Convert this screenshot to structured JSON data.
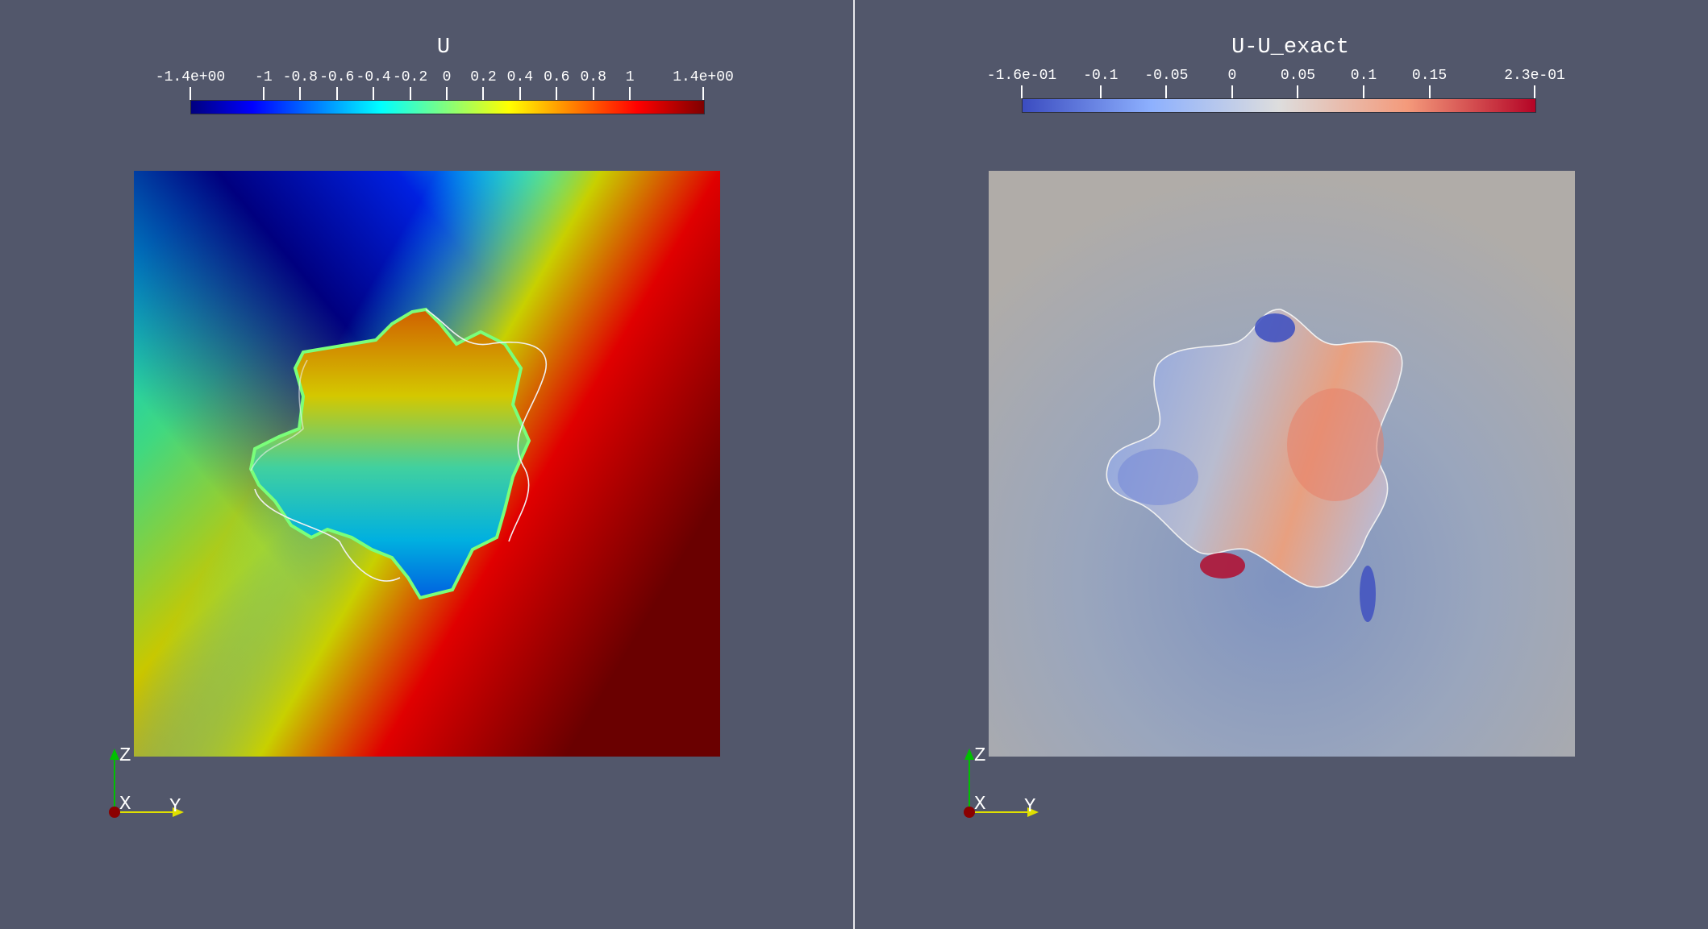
{
  "views": [
    {
      "id": "left",
      "colorbar": {
        "title": "U",
        "ticks": [
          "-1.4e+00",
          "-1",
          "-0.8",
          "-0.6",
          "-0.4",
          "-0.2",
          "0",
          "0.2",
          "0.4",
          "0.6",
          "0.8",
          "1",
          "1.4e+00"
        ],
        "tick_values": [
          -1.4,
          -1,
          -0.8,
          -0.6,
          -0.4,
          -0.2,
          0,
          0.2,
          0.4,
          0.6,
          0.8,
          1,
          1.4
        ],
        "range": [
          -1.4,
          1.4
        ],
        "colormap": "jet",
        "colors": [
          "#00007f",
          "#0000ff",
          "#00ffff",
          "#ffff00",
          "#ff0000",
          "#7f0000"
        ]
      },
      "axes": {
        "z": "Z",
        "x": "X",
        "y": "Y"
      }
    },
    {
      "id": "right",
      "colorbar": {
        "title": "U-U_exact",
        "ticks": [
          "-1.6e-01",
          "-0.1",
          "-0.05",
          "0",
          "0.05",
          "0.1",
          "0.15",
          "2.3e-01"
        ],
        "tick_values": [
          -0.16,
          -0.1,
          -0.05,
          0,
          0.05,
          0.1,
          0.15,
          0.23
        ],
        "range": [
          -0.16,
          0.23
        ],
        "colormap": "coolwarm",
        "colors": [
          "#3b4cc0",
          "#8db0fe",
          "#dddddd",
          "#f49a7b",
          "#b40426"
        ]
      },
      "axes": {
        "z": "Z",
        "x": "X",
        "y": "Y"
      }
    }
  ]
}
